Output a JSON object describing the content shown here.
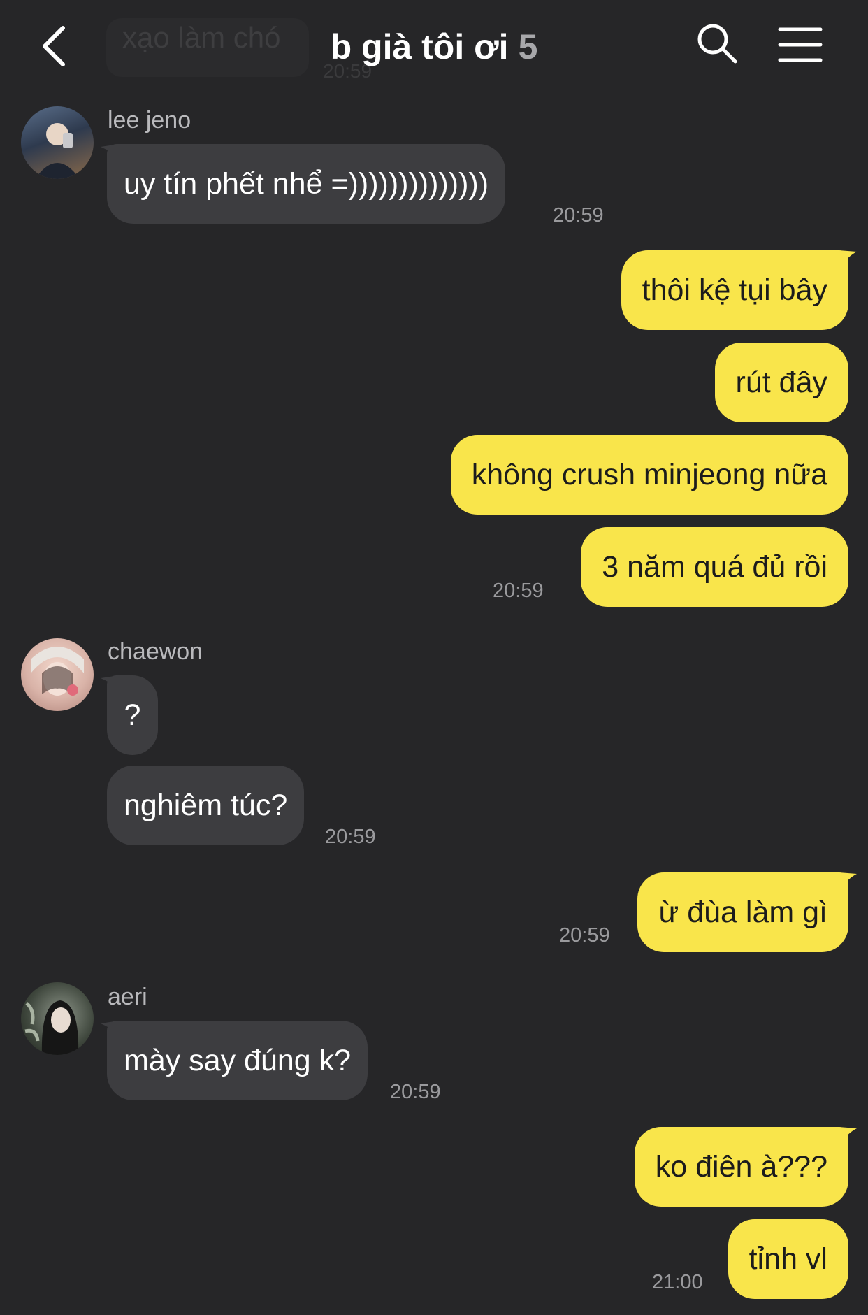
{
  "header": {
    "title": "b già tôi ơi",
    "member_count": "5",
    "faded_preview_text": "xạo làm chó",
    "faded_preview_time": "20:59"
  },
  "messages": [
    {
      "sender": "lee jeno",
      "text": "uy tín phết nhể =))))))))))))))",
      "time": "20:59"
    },
    {
      "text": "thôi kệ tụi bây"
    },
    {
      "text": "rút đây"
    },
    {
      "text": "không crush minjeong nữa"
    },
    {
      "text": "3 năm quá đủ rồi",
      "time": "20:59"
    },
    {
      "sender": "chaewon",
      "text": "?"
    },
    {
      "text": "nghiêm túc?",
      "time": "20:59"
    },
    {
      "text": "ừ đùa làm gì",
      "time": "20:59"
    },
    {
      "sender": "aeri",
      "text": "mày say đúng k?",
      "time": "20:59"
    },
    {
      "text": "ko điên à???"
    },
    {
      "text": "tỉnh vl",
      "time": "21:00"
    }
  ],
  "colors": {
    "background": "#262628",
    "incoming_bubble": "#3d3d40",
    "outgoing_bubble": "#f9e54b",
    "timestamp": "#9a9a9d"
  },
  "icons": {
    "back": "chevron-left-icon",
    "search": "search-icon",
    "menu": "hamburger-menu-icon"
  }
}
